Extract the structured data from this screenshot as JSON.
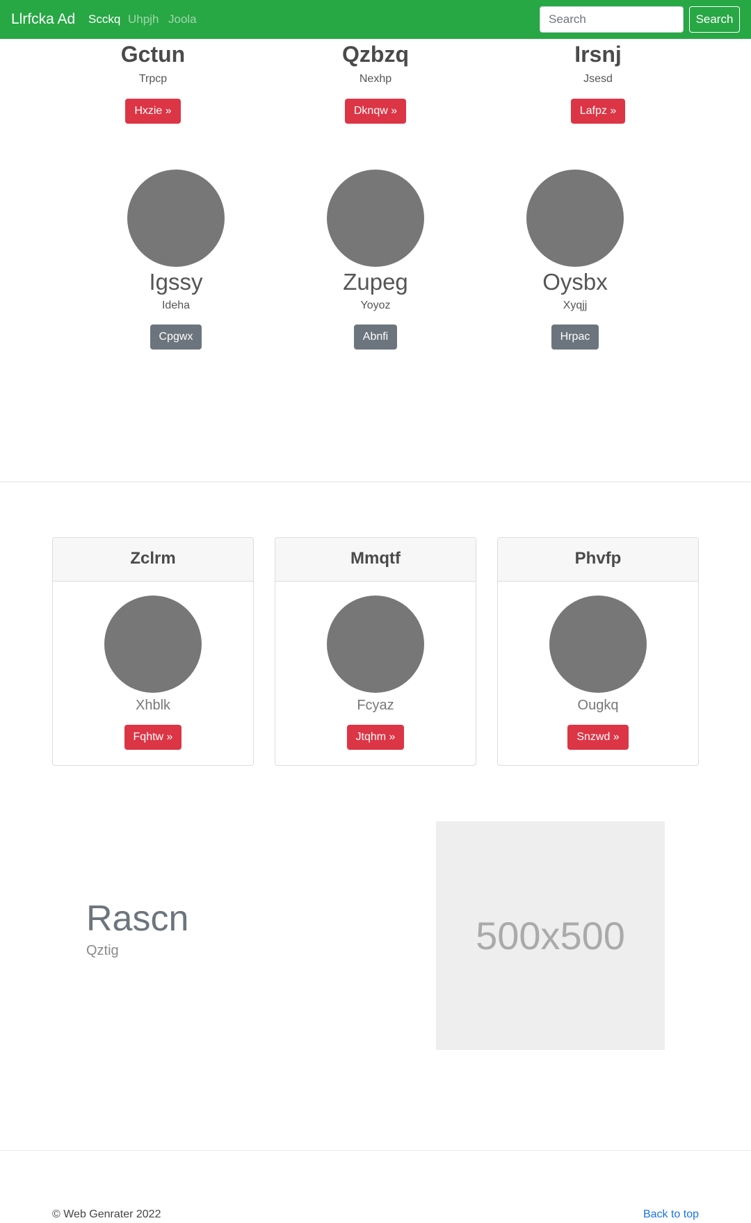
{
  "navbar": {
    "brand": "Llrfcka Ad",
    "links": [
      {
        "label": "Scckq",
        "active": true
      },
      {
        "label": "Uhpjh",
        "active": false
      },
      {
        "label": "Joola",
        "active": false
      }
    ],
    "search": {
      "placeholder": "Search",
      "button_label": "Search"
    },
    "color": "#28a745"
  },
  "top_columns": [
    {
      "title": "Gctun",
      "subtitle": "Trpcp",
      "button": "Hxzie »"
    },
    {
      "title": "Qzbzq",
      "subtitle": "Nexhp",
      "button": "Dknqw »"
    },
    {
      "title": "Irsnj",
      "subtitle": "Jsesd",
      "button": "Lafpz »"
    }
  ],
  "profiles": [
    {
      "name": "Igssy",
      "subtitle": "Ideha",
      "button": "Cpgwx"
    },
    {
      "name": "Zupeg",
      "subtitle": "Yoyoz",
      "button": "Abnfi"
    },
    {
      "name": "Oysbx",
      "subtitle": "Xyqjj",
      "button": "Hrpac"
    }
  ],
  "cards": [
    {
      "header": "Zclrm",
      "name": "Xhblk",
      "button": "Fqhtw »"
    },
    {
      "header": "Mmqtf",
      "name": "Fcyaz",
      "button": "Jtqhm »"
    },
    {
      "header": "Phvfp",
      "name": "Ougkq",
      "button": "Snzwd »"
    }
  ],
  "featurette": {
    "title": "Rascn",
    "subtitle": "Qztig",
    "image_label": "500x500"
  },
  "footer": {
    "copyright": "© Web Genrater 2022",
    "back_to_top": "Back to top"
  },
  "colors": {
    "danger": "#dc3545",
    "secondary": "#6c757d",
    "avatar": "#777777",
    "link": "#1a73e8"
  }
}
